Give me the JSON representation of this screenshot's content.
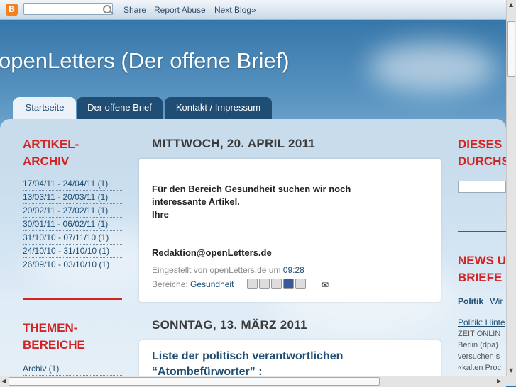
{
  "navbar": {
    "share": "Share",
    "report_abuse": "Report Abuse",
    "next_blog": "Next Blog»",
    "search_placeholder": ""
  },
  "blog": {
    "title": "openLetters (Der offene Brief)"
  },
  "tabs": [
    {
      "label": "Startseite"
    },
    {
      "label": "Der offene Brief"
    },
    {
      "label": "Kontakt / Impressum"
    }
  ],
  "sidebar": {
    "archive_title_1": "ARTIKEL-",
    "archive_title_2": "ARCHIV",
    "archive_items": [
      "17/04/11 - 24/04/11 (1)",
      "13/03/11 - 20/03/11 (1)",
      "20/02/11 - 27/02/11 (1)",
      "30/01/11 - 06/02/11 (1)",
      "31/10/10 - 07/11/10 (1)",
      "24/10/10 - 31/10/10 (1)",
      "26/09/10 - 03/10/10 (1)"
    ],
    "themes_title_1": "THEMEN-",
    "themes_title_2": "BEREICHE",
    "themes_items": [
      "Archiv (1)"
    ]
  },
  "posts": [
    {
      "date": "MITTWOCH, 20. APRIL 2011",
      "line1": "Für den Bereich Gesundheit suchen wir noch",
      "line2": "interessante Artikel.",
      "line3": "Ihre",
      "signature": "Redaktion@openLetters.de",
      "posted_by": "Eingestellt von openLetters.de um",
      "time": "09:28",
      "labels_prefix": "Bereiche:",
      "label": "Gesundheit"
    },
    {
      "date": "SONNTAG, 13. MÄRZ 2011",
      "title_line1": "Liste der politisch verantwortlichen",
      "title_line2": "“Atombefürworter” :"
    }
  ],
  "right": {
    "title1_a": "DIESES",
    "title1_b": "DURCHS",
    "title2_a": "NEWS U",
    "title2_b": "BRIEFE",
    "tab_politik": "Politik",
    "tab_wir": "Wir",
    "link": "Politik: Hinte",
    "line1": "ZEIT ONLIN",
    "line2": "Berlin (dpa)",
    "line3": "versuchen s",
    "line4": "«kalten Proc"
  },
  "colors": {
    "accent_red": "#d32323",
    "nav_blue": "#1f4d73"
  }
}
